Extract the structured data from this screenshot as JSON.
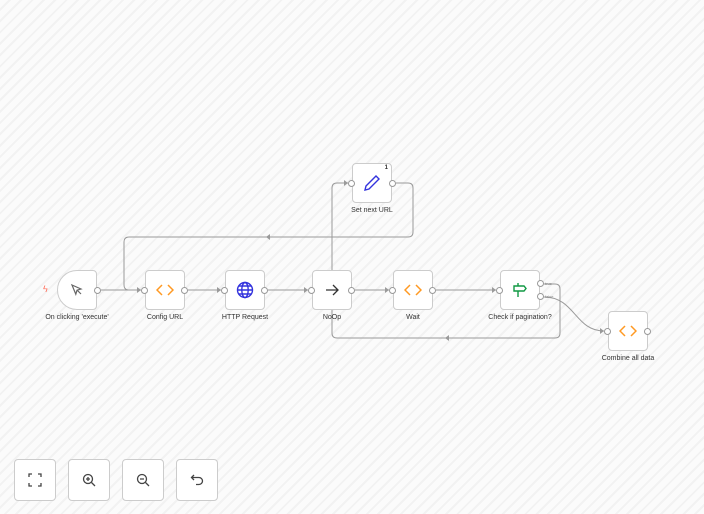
{
  "nodes": [
    {
      "id": "trigger",
      "label": "On clicking 'execute'",
      "icon": "cursor-icon"
    },
    {
      "id": "config",
      "label": "Config URL",
      "icon": "code-icon"
    },
    {
      "id": "http",
      "label": "HTTP Request",
      "icon": "globe-icon"
    },
    {
      "id": "noop",
      "label": "NoOp",
      "icon": "arrow-right-icon"
    },
    {
      "id": "wait",
      "label": "Wait",
      "icon": "code-icon"
    },
    {
      "id": "check",
      "label": "Check if pagination?",
      "icon": "signpost-icon",
      "outputs": [
        "true",
        "false"
      ]
    },
    {
      "id": "setnext",
      "label": "Set next URL",
      "icon": "pencil-icon",
      "badge": "1"
    },
    {
      "id": "combine",
      "label": "Combine all data",
      "icon": "code-icon"
    }
  ],
  "controls": [
    {
      "name": "fit-view",
      "icon": "fullscreen-icon"
    },
    {
      "name": "zoom-in",
      "icon": "zoom-in-icon"
    },
    {
      "name": "zoom-out",
      "icon": "zoom-out-icon"
    },
    {
      "name": "reset",
      "icon": "undo-icon"
    }
  ],
  "colors": {
    "code": "#ff9922",
    "globe": "#3333dd",
    "pencil": "#3333dd",
    "signpost": "#119944",
    "trigger": "#ff6d5a",
    "edge": "#9a9a9a"
  }
}
